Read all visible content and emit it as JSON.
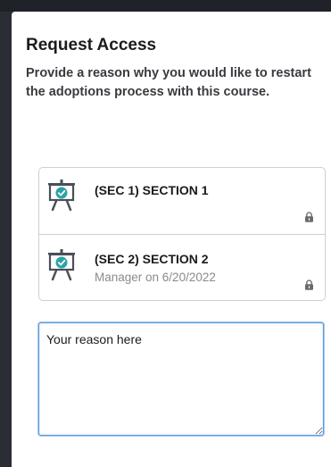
{
  "dialog": {
    "title": "Request Access",
    "description": "Provide a reason why you would like to restart the adoptions process with this course."
  },
  "sections": [
    {
      "name": "(SEC 1) SECTION 1",
      "subtitle": "",
      "icon": "presentation-check-icon",
      "locked": true
    },
    {
      "name": "(SEC 2) SECTION 2",
      "subtitle": "Manager on 6/20/2022",
      "icon": "presentation-check-icon",
      "locked": true
    }
  ],
  "reason_field": {
    "placeholder": "Your reason here",
    "value": ""
  },
  "colors": {
    "accent": "#2aa3a8",
    "border": "#cfcfcf",
    "focus": "#5b9bd5"
  }
}
